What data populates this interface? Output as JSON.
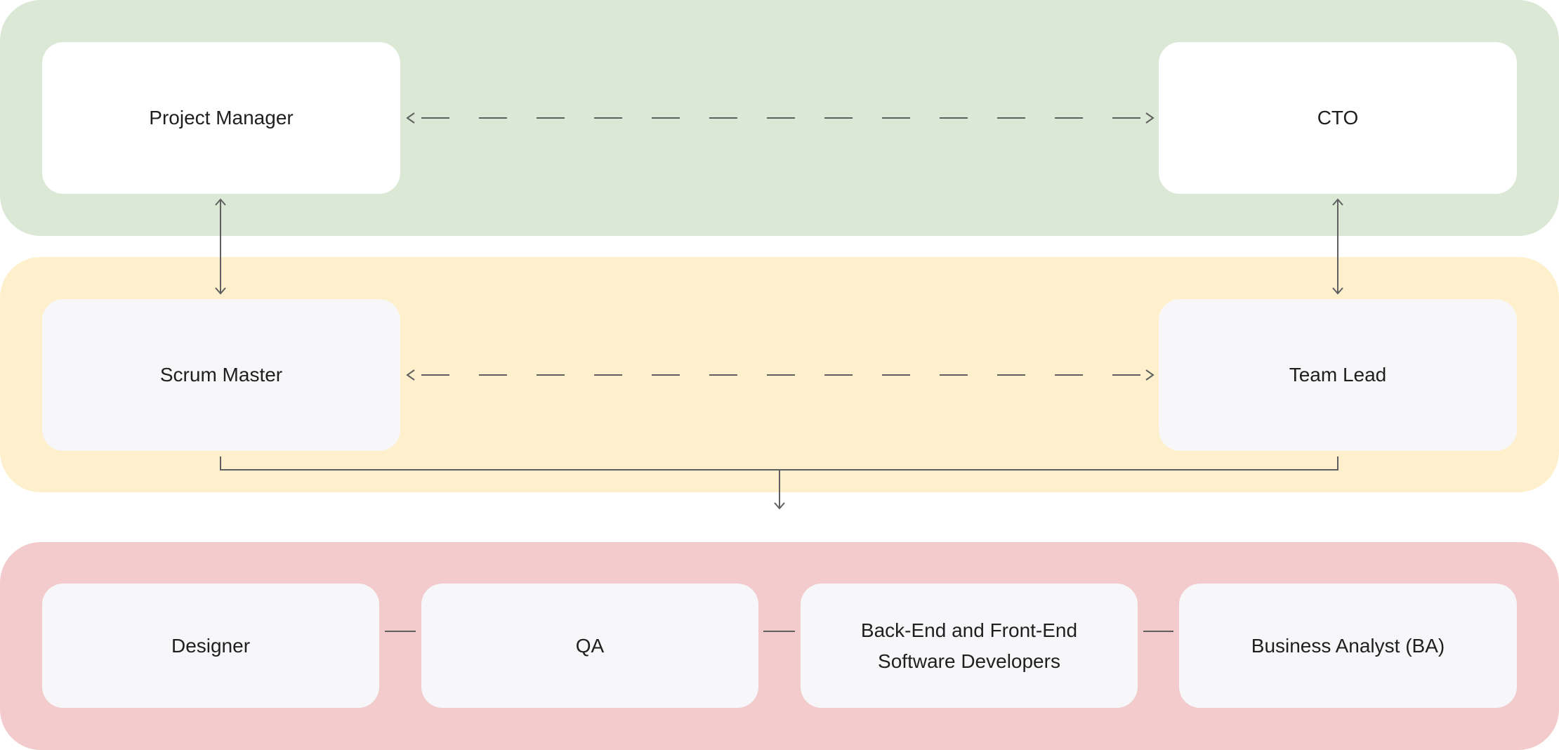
{
  "colors": {
    "executive_band": "#dbe8d5",
    "management_band": "#fef0cc",
    "team_band": "#f3cbcc",
    "line": "#5f5f5f"
  },
  "executive": {
    "left": "Project Manager",
    "right": "CTO"
  },
  "management": {
    "left": "Scrum Master",
    "right": "Team Lead"
  },
  "team": {
    "designer": "Designer",
    "qa": "QA",
    "developers_line1": "Back-End and Front-End",
    "developers_line2": "Software Developers",
    "ba": "Business Analyst (BA)"
  }
}
